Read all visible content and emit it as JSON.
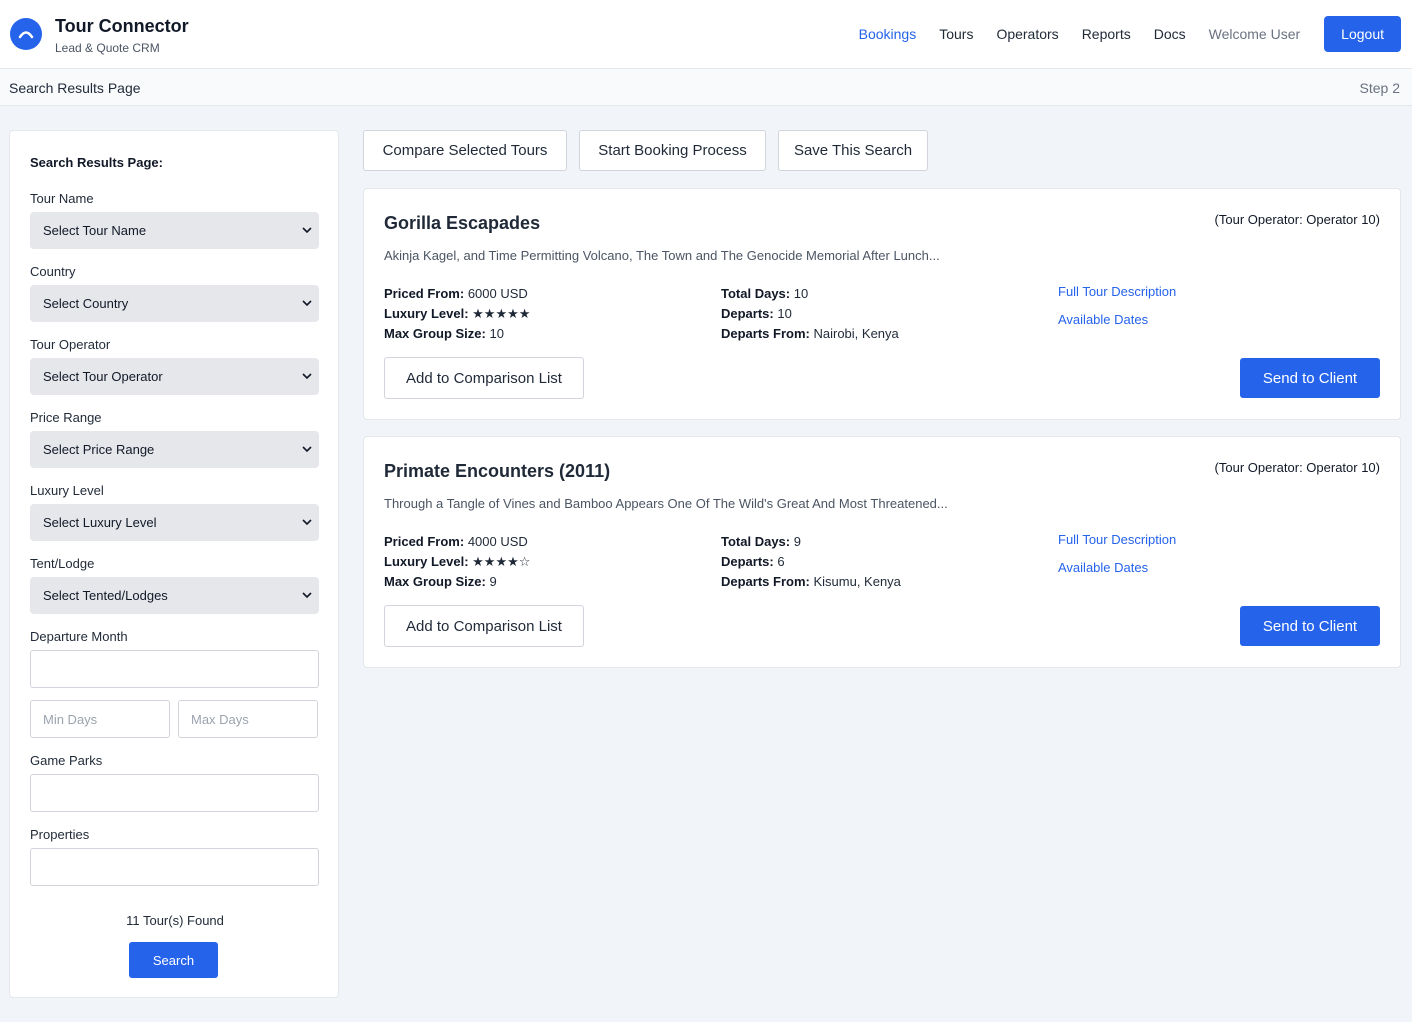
{
  "header": {
    "brand_title": "Tour Connector",
    "brand_subtitle": "Lead & Quote CRM",
    "nav": [
      "Bookings",
      "Tours",
      "Operators",
      "Reports",
      "Docs"
    ],
    "active_nav": "Bookings",
    "welcome": "Welcome User",
    "logout": "Logout",
    "accent_color": "#2563eb"
  },
  "subbar": {
    "page_name": "Search Results Page",
    "step": "Step 2"
  },
  "sidebar": {
    "heading": "Search Results Page:",
    "fields": {
      "tour_name": {
        "label": "Tour Name",
        "value": "Select Tour Name"
      },
      "country": {
        "label": "Country",
        "value": "Select Country"
      },
      "tour_operator": {
        "label": "Tour Operator",
        "value": "Select Tour Operator"
      },
      "price_range": {
        "label": "Price Range",
        "value": "Select Price Range"
      },
      "luxury_level": {
        "label": "Luxury Level",
        "value": "Select Luxury Level"
      },
      "tent_lodge": {
        "label": "Tent/Lodge",
        "value": "Select Tented/Lodges"
      },
      "departure_month": {
        "label": "Departure Month",
        "value": ""
      },
      "min_days": {
        "placeholder": "Min Days"
      },
      "max_days": {
        "placeholder": "Max Days"
      },
      "game_parks": {
        "label": "Game Parks",
        "value": ""
      },
      "properties": {
        "label": "Properties",
        "value": ""
      }
    },
    "found": "11 Tour(s) Found",
    "search_button": "Search"
  },
  "actions": {
    "compare": "Compare Selected Tours",
    "booking": "Start Booking Process",
    "save": "Save This Search"
  },
  "labels": {
    "priced_from": "Priced From:",
    "luxury_level": "Luxury Level:",
    "max_group": "Max Group Size:",
    "total_days": "Total Days:",
    "departs": "Departs:",
    "departs_from": "Departs From:",
    "full_desc": "Full Tour Description",
    "available_dates": "Available Dates",
    "add_compare": "Add to Comparison List",
    "send": "Send to Client"
  },
  "tours": [
    {
      "title": "Gorilla Escapades",
      "operator": "(Tour Operator: Operator 10)",
      "description": "Akinja Kagel, and Time Permitting Volcano, The Town and The Genocide Memorial After Lunch...",
      "priced_from": "6000 USD",
      "luxury": "★★★★★",
      "max_group": "10",
      "total_days": "10",
      "departs": "10",
      "departs_from": "Nairobi, Kenya"
    },
    {
      "title": "Primate Encounters (2011)",
      "operator": "(Tour Operator: Operator 10)",
      "description": "Through a Tangle of Vines and Bamboo Appears One Of The Wild's Great And Most Threatened...",
      "priced_from": "4000 USD",
      "luxury": "★★★★☆",
      "max_group": "9",
      "total_days": "9",
      "departs": "6",
      "departs_from": "Kisumu, Kenya"
    }
  ]
}
